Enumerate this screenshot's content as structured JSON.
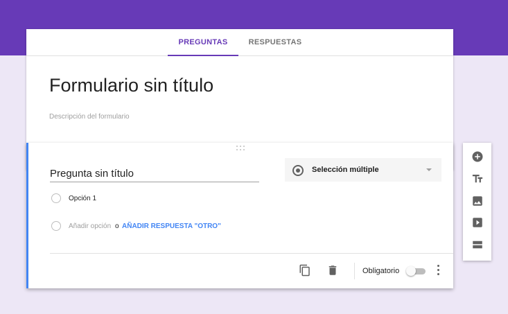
{
  "tabs": [
    {
      "label": "PREGUNTAS",
      "active": true
    },
    {
      "label": "RESPUESTAS",
      "active": false
    }
  ],
  "form": {
    "title": "Formulario sin título",
    "description_placeholder": "Descripción del formulario"
  },
  "question": {
    "title": "Pregunta sin título",
    "type_label": "Selección múltiple",
    "options": [
      "Opción 1"
    ],
    "add_option_label": "Añadir opción",
    "or_label": "o",
    "add_other_label": "AÑADIR RESPUESTA \"OTRO\"",
    "required_label": "Obligatorio",
    "required": false
  },
  "side_toolbar": [
    "add-question-icon",
    "add-title-icon",
    "add-image-icon",
    "add-video-icon",
    "add-section-icon"
  ],
  "colors": {
    "accent": "#673ab7",
    "background": "#ede7f6",
    "link": "#4285f4"
  }
}
